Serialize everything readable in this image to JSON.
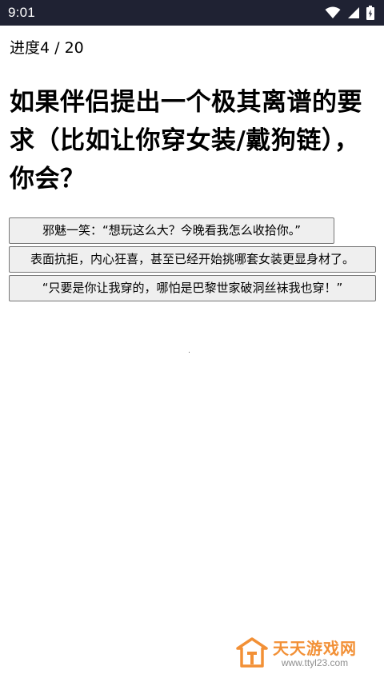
{
  "status_bar": {
    "time": "9:01",
    "icons": [
      "wifi-icon",
      "signal-icon",
      "battery-icon"
    ]
  },
  "progress": {
    "label": "进度4 / 20"
  },
  "question": {
    "text": "如果伴侣提出一个极其离谱的要求（比如让你穿女装/戴狗链），你会？"
  },
  "options": [
    {
      "label": "邪魅一笑：“想玩这么大？今晚看我怎么收拾你。”"
    },
    {
      "label": "表面抗拒，内心狂喜，甚至已经开始挑哪套女装更显身材了。"
    },
    {
      "label": "“只要是你让我穿的，哪怕是巴黎世家破洞丝袜我也穿！”"
    }
  ],
  "watermark": {
    "name": "天天游戏网",
    "url": "www.ttyl23.com",
    "accent_color": "#f28b2c"
  }
}
